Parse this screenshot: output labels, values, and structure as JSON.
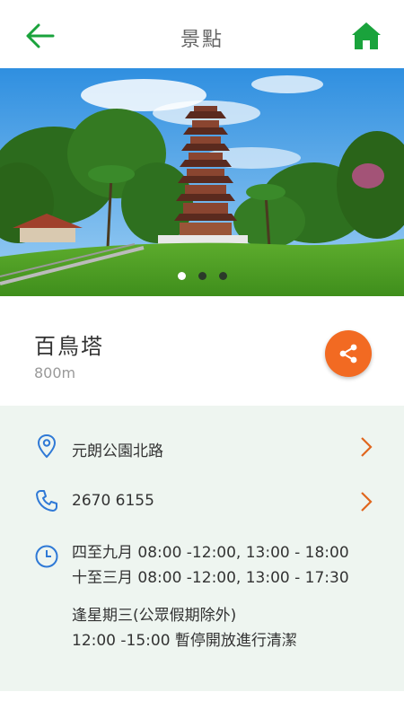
{
  "header": {
    "title": "景點",
    "back_icon": "arrow-left-icon",
    "home_icon": "home-icon",
    "accent_color": "#1aa33c"
  },
  "hero": {
    "carousel_dots": 3,
    "active_index": 0
  },
  "place": {
    "name": "百鳥塔",
    "distance": "800m",
    "share_icon": "share-icon",
    "share_color": "#f26a22"
  },
  "info": {
    "address": "元朗公園北路",
    "phone": "2670 6155",
    "hours": [
      "四至九月 08:00 -12:00, 13:00 - 18:00",
      "十至三月 08:00 -12:00, 13:00 - 17:30"
    ],
    "notes": [
      "逢星期三(公眾假期除外)",
      "12:00 -15:00 暫停開放進行清潔"
    ],
    "icon_color": "#2f79d6",
    "chevron_color": "#e0661e",
    "background": "#eef5f0"
  }
}
